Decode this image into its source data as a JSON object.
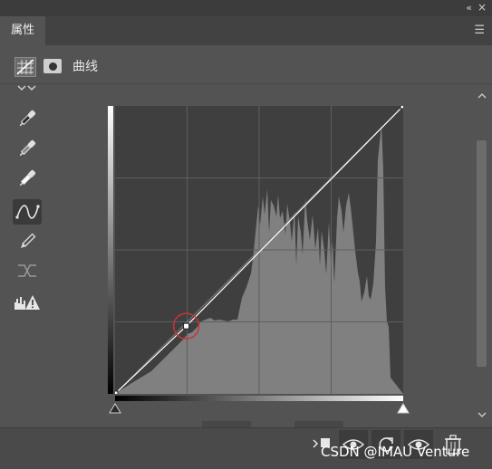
{
  "window": {
    "collapse_icon": "double-chevron-left-icon",
    "close_icon": "close-icon"
  },
  "panel": {
    "tab_label": "属性",
    "menu_icon": "hamburger-menu-icon"
  },
  "header": {
    "adjustment_icon": "curves-adjustment-icon",
    "mask_icon": "layer-mask-icon",
    "title": "曲线"
  },
  "tools": [
    {
      "name": "sample-black-eyedropper-icon",
      "active": false
    },
    {
      "name": "sample-gray-eyedropper-icon",
      "active": false
    },
    {
      "name": "sample-white-eyedropper-icon",
      "active": false
    },
    {
      "name": "edit-points-curve-icon",
      "active": true
    },
    {
      "name": "pencil-draw-icon",
      "active": false
    },
    {
      "name": "smooth-curve-icon",
      "active": false
    },
    {
      "name": "clipping-warning-icon",
      "active": false
    }
  ],
  "curve": {
    "input_range": [
      0,
      255
    ],
    "output_range": [
      0,
      255
    ],
    "grid_divisions": 4,
    "points": [
      {
        "input": 0,
        "output": 0,
        "highlighted": false
      },
      {
        "input": 63,
        "output": 60,
        "highlighted": true
      },
      {
        "input": 255,
        "output": 255,
        "highlighted": false
      }
    ],
    "colors": {
      "curve": "#ffffff",
      "histogram": "#808080",
      "highlight_ring": "#cc3333"
    }
  },
  "bottom_actions": [
    {
      "name": "clip-to-layer-icon"
    },
    {
      "name": "view-previous-state-icon"
    },
    {
      "name": "reset-adjustment-icon"
    },
    {
      "name": "toggle-visibility-icon"
    },
    {
      "name": "delete-icon"
    }
  ],
  "watermark": "CSDN @IMAU Venture"
}
